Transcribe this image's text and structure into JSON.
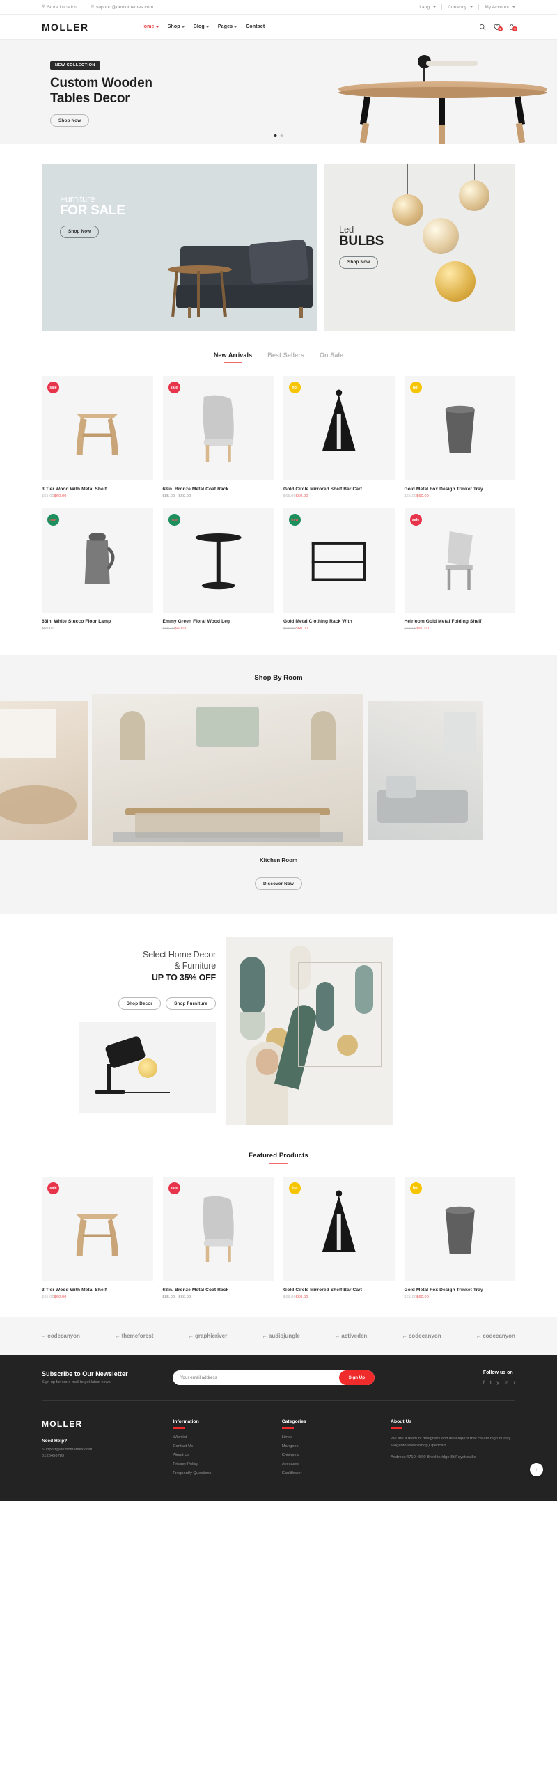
{
  "topbar": {
    "store_location": "Store Location",
    "email": "support@demothemes.com",
    "lang": "Lang",
    "currency": "Currency",
    "account": "My Account"
  },
  "header": {
    "logo": "MOLLER",
    "nav": [
      {
        "label": "Home",
        "caret": true,
        "active": true
      },
      {
        "label": "Shop",
        "caret": true,
        "active": false
      },
      {
        "label": "Blog",
        "caret": true,
        "active": false
      },
      {
        "label": "Pages",
        "caret": true,
        "active": false
      },
      {
        "label": "Contact",
        "caret": false,
        "active": false
      }
    ],
    "icons": [
      {
        "name": "search-icon",
        "badge": ""
      },
      {
        "name": "wishlist-icon",
        "badge": "0"
      },
      {
        "name": "cart-icon",
        "badge": "0"
      }
    ]
  },
  "hero": {
    "badge": "NEW COLLECTION",
    "title_line1": "Custom Wooden",
    "title_line2": "Tables Decor",
    "cta": "Shop Now",
    "slide_current": 1,
    "slide_total": 2
  },
  "promo": {
    "left": {
      "small": "Furniture",
      "large": "FOR SALE",
      "cta": "Shop Now"
    },
    "right": {
      "small": "Led",
      "large": "BULBS",
      "cta": "Shop Now"
    }
  },
  "products_section": {
    "tabs": [
      {
        "label": "New Arrivals",
        "active": true
      },
      {
        "label": "Best Sellers",
        "active": false
      },
      {
        "label": "On Sale",
        "active": false
      }
    ],
    "items": [
      {
        "name": "3 Tier Wood With Metal Shelf",
        "old": "$65.00",
        "new": "$60.00",
        "badge": "sale",
        "badge_type": "sale",
        "art": "stool"
      },
      {
        "name": "68in. Bronze Metal Coat Rack",
        "old": "",
        "new": "",
        "plain": "$85.00 - $60.00",
        "badge": "sale",
        "badge_type": "sale",
        "art": "chair"
      },
      {
        "name": "Gold Circle Mirrored Shelf Bar Cart",
        "old": "$65.00",
        "new": "$60.00",
        "badge": "hot",
        "badge_type": "hot",
        "art": "lampblack"
      },
      {
        "name": "Gold Metal Fox Design Trinket Tray",
        "old": "$65.00",
        "new": "$60.00",
        "badge": "hot",
        "badge_type": "hot",
        "art": "bin"
      },
      {
        "name": "63in. White Stucco Floor Lamp",
        "old": "",
        "new": "",
        "plain": "$65.00",
        "badge": "new",
        "badge_type": "new",
        "art": "jug"
      },
      {
        "name": "Emmy Green Floral Wood Leg",
        "old": "$65.00",
        "new": "$60.00",
        "badge": "new",
        "badge_type": "new",
        "art": "stand"
      },
      {
        "name": "Gold Metal Clothing Rack With",
        "old": "$65.00",
        "new": "$60.00",
        "badge": "new",
        "badge_type": "new",
        "art": "table"
      },
      {
        "name": "Heirloom Gold Metal Folding Shelf",
        "old": "$65.00",
        "new": "$60.00",
        "badge": "sale",
        "badge_type": "sale",
        "art": "chair2"
      }
    ]
  },
  "room_section": {
    "title": "Shop By Room",
    "room_name": "Kitchen Room",
    "cta": "Discover Now"
  },
  "decor": {
    "line1": "Select Home Decor",
    "line2": "& Furniture",
    "line3": "UP TO 35% OFF",
    "btn1": "Shop Decor",
    "btn2": "Shop Furniture"
  },
  "featured": {
    "title": "Featured Products",
    "items": [
      {
        "name": "3 Tier Wood With Metal Shelf",
        "old": "$65.00",
        "new": "$60.00",
        "badge": "sale",
        "badge_type": "sale",
        "art": "stool"
      },
      {
        "name": "68in. Bronze Metal Coat Rack",
        "old": "",
        "new": "",
        "plain": "$85.00 - $60.00",
        "badge": "sale",
        "badge_type": "sale",
        "art": "chair"
      },
      {
        "name": "Gold Circle Mirrored Shelf Bar Cart",
        "old": "$65.00",
        "new": "$60.00",
        "badge": "hot",
        "badge_type": "hot",
        "art": "lampblack"
      },
      {
        "name": "Gold Metal Fox Design Trinket Tray",
        "old": "$65.00",
        "new": "$60.00",
        "badge": "hot",
        "badge_type": "hot",
        "art": "bin"
      }
    ]
  },
  "brands": [
    {
      "label": "codecanyon"
    },
    {
      "label": "themeforest"
    },
    {
      "label": "graphicriver"
    },
    {
      "label": "audiojungle"
    },
    {
      "label": "activeden"
    },
    {
      "label": "codecanyon"
    },
    {
      "label": "codecanyon"
    }
  ],
  "newsletter": {
    "title": "Subscribe to Our Newsletter",
    "subtitle": "Sign up for our e-mail to get latest news.",
    "placeholder": "Your email address",
    "button": "Sign Up",
    "follow_title": "Follow us on",
    "socials": [
      "f",
      "t",
      "y",
      "in",
      "r"
    ]
  },
  "footer": {
    "logo": "MOLLER",
    "need_help": "Need Help?",
    "email": "Support@demothemes.com",
    "phone": "0123456789",
    "col_information": {
      "head": "Information",
      "links": [
        "Wishlist",
        "Contact Us",
        "About Us",
        "Privacy Policy",
        "Frequently Questions"
      ]
    },
    "col_categories": {
      "head": "Categories",
      "links": [
        "Limes",
        "Mangoes",
        "Chickpea",
        "Avocados",
        "Cauliflower"
      ]
    },
    "col_about": {
      "head": "About Us",
      "body": "We are a team of designers and developers that create high quality Magento,Prestashop,Opencart.",
      "address": "Address:4710-4890 Breckinridge St,Fayetteville"
    }
  },
  "colors": {
    "accent": "#ef2b2b",
    "accent_soft": "#ef6b6b",
    "sale": "#e8344a",
    "hot": "#f6c500",
    "new": "#1d8f5e",
    "dark": "#232323"
  }
}
